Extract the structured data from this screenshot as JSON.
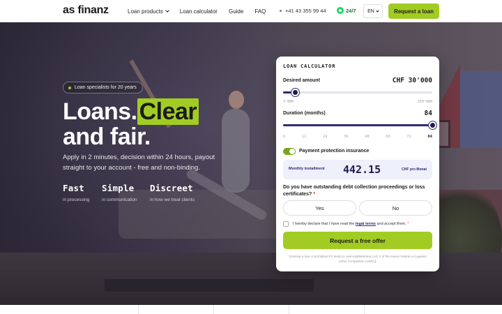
{
  "header": {
    "logo": "as finanz",
    "nav": [
      {
        "label": "Loan products",
        "dropdown": true
      },
      {
        "label": "Loan calculator"
      },
      {
        "label": "Guide"
      },
      {
        "label": "FAQ"
      }
    ],
    "phone": "+41 43 355 99 44",
    "whatsapp": "24/7",
    "language": "EN",
    "cta": "Request a loan"
  },
  "hero": {
    "badge": "Loan specialists for 20 years",
    "headline_highlight": "Clear",
    "headline_pre": "Loans.",
    "headline_line2": "and fair.",
    "lead": "Apply in 2 minutes, decision within 24 hours, payout straight to your account - free and non-binding.",
    "features": [
      {
        "title": "Fast",
        "subtitle": "in processing"
      },
      {
        "title": "Simple",
        "subtitle": "in communication"
      },
      {
        "title": "Discreet",
        "subtitle": "in how we treat clients"
      }
    ]
  },
  "calculator": {
    "title": "LOAN CALCULATOR",
    "amount_label": "Desired amount",
    "amount_value": "CHF 30'000",
    "amount_min": "3'000",
    "amount_max": "250'000",
    "amount_fraction": 0.08,
    "duration_label": "Duration (months)",
    "duration_value": "84",
    "duration_ticks": [
      "6",
      "12",
      "24",
      "36",
      "48",
      "60",
      "72",
      "84"
    ],
    "duration_fraction": 1.0,
    "insurance_label": "Payment protection insurance",
    "insurance_on": true,
    "installment_label": "Monthly installment",
    "installment_value": "442.15",
    "installment_unit": "CHF pro Monat",
    "question": "Do you have outstanding debt collection proceedings or loss certificates?",
    "required_mark": "*",
    "yes": "Yes",
    "no": "No",
    "terms_pre": "I hereby declare that I have read the ",
    "terms_link": "legal terms",
    "terms_post": " and accept them.",
    "submit": "Request a free offer",
    "disclaimer": "Granting a loan is prohibited if it leads to over-indebtedness (Art. 3 of the Swiss Federal Act against Unfair Competition (UWG))."
  },
  "colors": {
    "accent": "#a2cc23",
    "navy": "#2f2a72"
  }
}
